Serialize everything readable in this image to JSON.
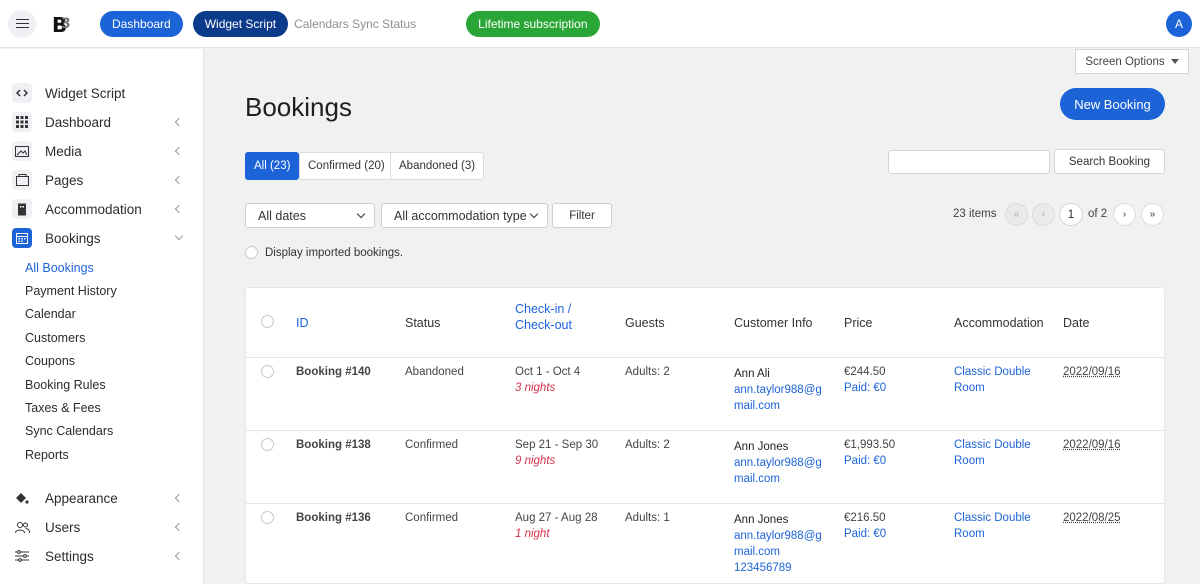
{
  "topbar": {
    "dashboard": "Dashboard",
    "widget_script": "Widget Script",
    "sync_status": "Calendars Sync Status",
    "lifetime": "Lifetime subscription",
    "avatar": "A"
  },
  "sidebar": {
    "items": [
      {
        "label": "Widget Script"
      },
      {
        "label": "Dashboard"
      },
      {
        "label": "Media"
      },
      {
        "label": "Pages"
      },
      {
        "label": "Accommodation"
      },
      {
        "label": "Bookings"
      }
    ],
    "sub": [
      "All Bookings",
      "Payment History",
      "Calendar",
      "Customers",
      "Coupons",
      "Booking Rules",
      "Taxes & Fees",
      "Sync Calendars",
      "Reports"
    ],
    "bottom": [
      {
        "label": "Appearance"
      },
      {
        "label": "Users"
      },
      {
        "label": "Settings"
      }
    ]
  },
  "main": {
    "screen_options": "Screen Options",
    "title": "Bookings",
    "new_booking": "New Booking",
    "tabs": [
      "All (23)",
      "Confirmed (20)",
      "Abandoned (3)"
    ],
    "search_button": "Search Booking",
    "dates_select": "All dates",
    "accommodation_select": "All accommodation type",
    "filter": "Filter",
    "items_count": "23 items",
    "pager": {
      "first": "«",
      "prev": "‹",
      "page": "1",
      "of": "of 2",
      "next": "›",
      "last": "»"
    },
    "display_imported": "Display imported bookings."
  },
  "table": {
    "headers": {
      "id": "ID",
      "status": "Status",
      "checkin_1": "Check-in /",
      "checkin_2": "Check-out",
      "guests": "Guests",
      "customer": "Customer Info",
      "price": "Price",
      "accommodation": "Accommodation",
      "date": "Date"
    },
    "rows": [
      {
        "id": "Booking #140",
        "status": "Abandoned",
        "dates": "Oct 1 - Oct 4",
        "nights": "3 nights",
        "guests": "Adults: 2",
        "name": "Ann Ali",
        "email1": "ann.taylor988@g",
        "email2": "mail.com",
        "phone": "",
        "price": "€244.50",
        "paid": "Paid: €0",
        "acc1": "Classic Double",
        "acc2": "Room",
        "date": "2022/09/16"
      },
      {
        "id": "Booking #138",
        "status": "Confirmed",
        "dates": "Sep 21 - Sep 30",
        "nights": "9 nights",
        "guests": "Adults: 2",
        "name": "Ann Jones",
        "email1": "ann.taylor988@g",
        "email2": "mail.com",
        "phone": "",
        "price": "€1,993.50",
        "paid": "Paid: €0",
        "acc1": "Classic Double",
        "acc2": "Room",
        "date": "2022/09/16"
      },
      {
        "id": "Booking #136",
        "status": "Confirmed",
        "dates": "Aug 27 - Aug 28",
        "nights": "1 night",
        "guests": "Adults: 1",
        "name": "Ann Jones",
        "email1": "ann.taylor988@g",
        "email2": "mail.com",
        "phone": "123456789",
        "price": "€216.50",
        "paid": "Paid: €0",
        "acc1": "Classic Double",
        "acc2": "Room",
        "date": "2022/08/25"
      }
    ]
  }
}
